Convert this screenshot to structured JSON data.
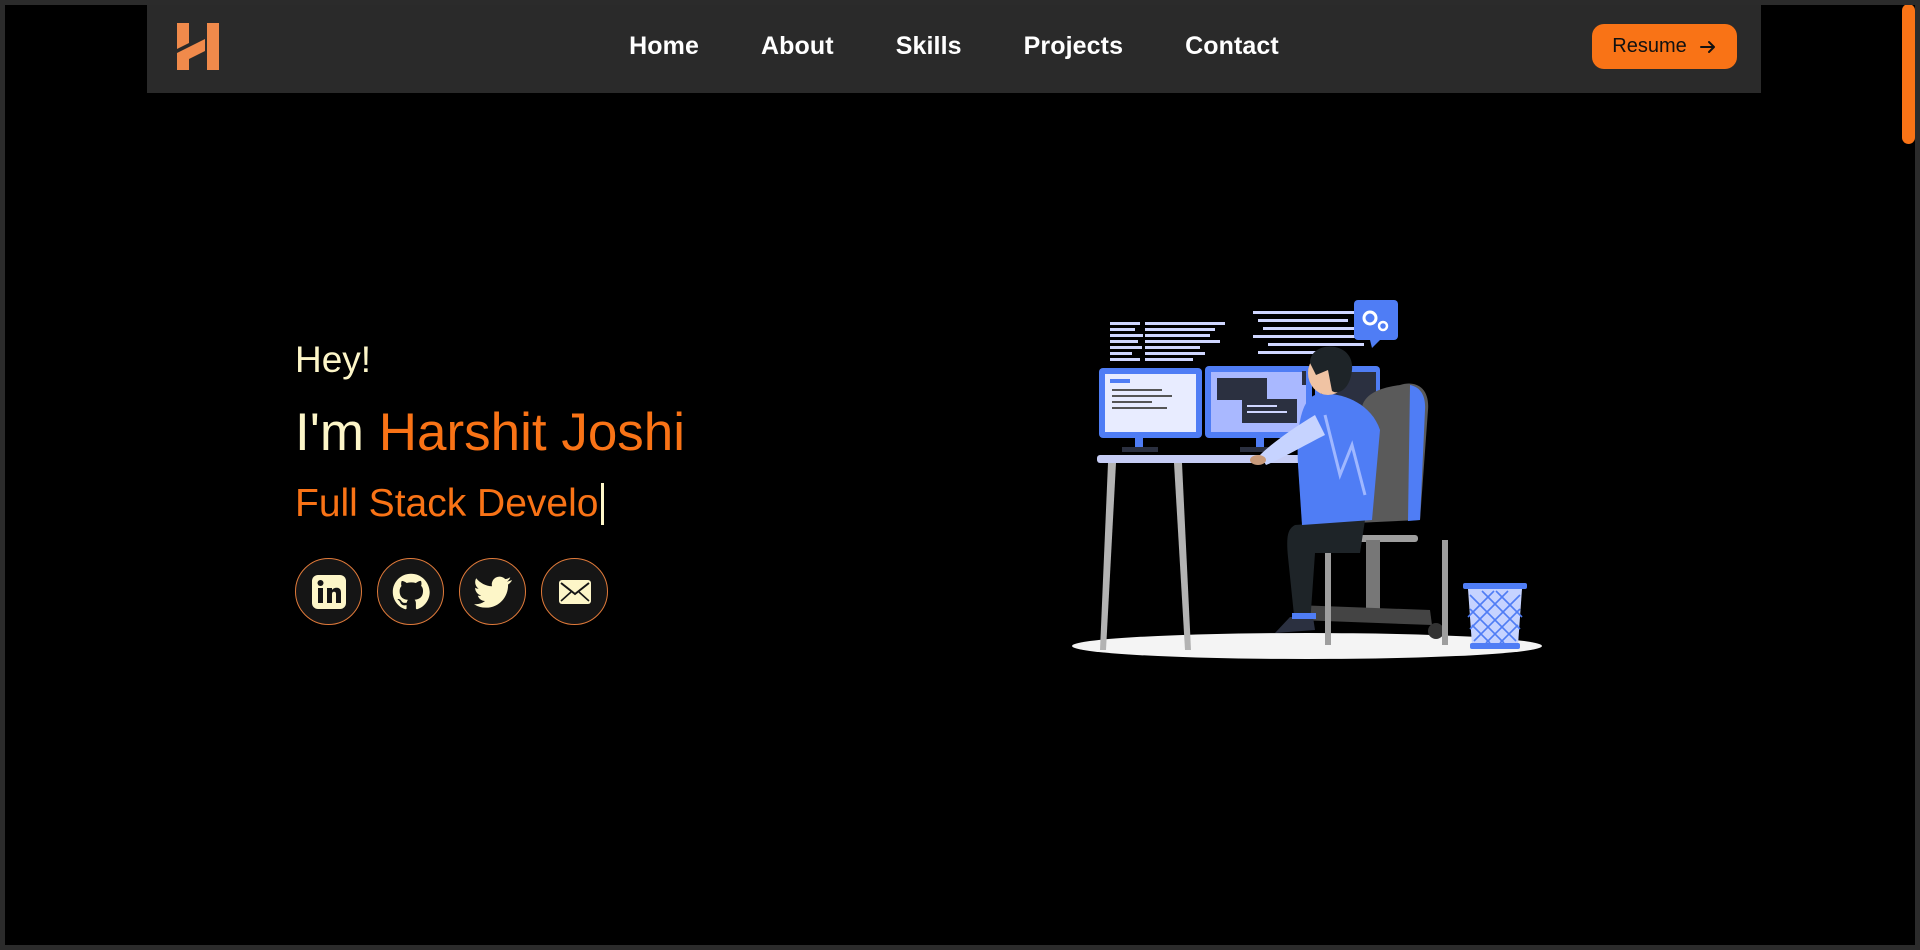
{
  "header": {
    "logo_icon": "h-logo-icon",
    "nav": [
      "Home",
      "About",
      "Skills",
      "Projects",
      "Contact"
    ],
    "resume_label": "Resume",
    "resume_icon": "arrow-right-icon"
  },
  "hero": {
    "greeting": "Hey!",
    "intro_prefix": "I'm",
    "name": "Harshit Joshi",
    "role_typed": "Full Stack Develo",
    "socials": [
      "linkedin-icon",
      "github-icon",
      "twitter-icon",
      "mail-icon"
    ],
    "illustration": "developer-at-desk-illustration"
  },
  "colors": {
    "accent": "#f97316",
    "text_cream": "#fdf6c8",
    "navbar_bg": "#2a2a2a",
    "page_bg": "#000000",
    "illustration_blue": "#4f7df5"
  }
}
